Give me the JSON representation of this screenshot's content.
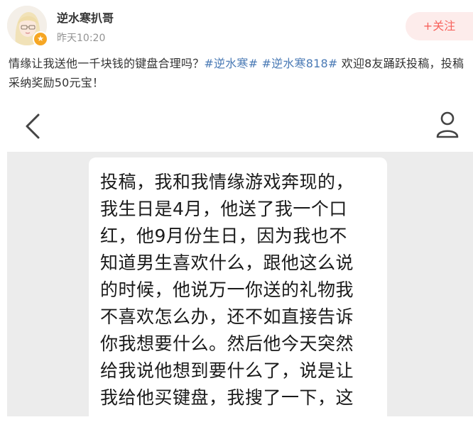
{
  "header": {
    "username": "逆水寒扒哥",
    "timestamp": "昨天10:20",
    "follow_label": "+关注",
    "avatar_icon": "anime-girl-avatar",
    "badge_icon": "verified-star-icon"
  },
  "post": {
    "text_before": "情缘让我送他一千块钱的键盘合理吗？",
    "hashtags": [
      "#逆水寒#",
      "#逆水寒818#"
    ],
    "text_after": " 欢迎8友踊跃投稿，投稿采纳奖励50元宝！"
  },
  "embedded_screenshot": {
    "back_icon": "chevron-left-icon",
    "profile_icon": "person-icon",
    "message_lines": [
      "投稿，我和我情缘游戏奔现的，",
      "我生日是4月，他送了我一个口",
      "红，他9月份生日，因为我也不",
      "知道男生喜欢什么，跟他这么说",
      "的时候，他说万一你送的礼物我",
      "不喜欢怎么办，还不如直接告诉",
      "你我想要什么。然后他今天突然",
      "给我说他想到要什么了，说是让",
      "我给他买键盘，我搜了一下，这"
    ]
  },
  "colors": {
    "accent_hashtag": "#4a7ab5",
    "follow_bg": "#fdeceb",
    "follow_text": "#f7625c",
    "chat_bg": "#ececec"
  }
}
